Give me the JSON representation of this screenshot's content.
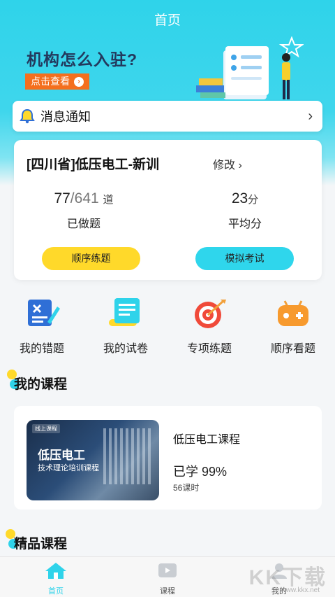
{
  "topbar": {
    "title": "首页"
  },
  "banner": {
    "title": "机构怎么入驻?",
    "button_label": "点击查看"
  },
  "notice": {
    "label": "消息通知"
  },
  "stats": {
    "course_name": "[四川省]低压电工-新训",
    "modify_label": "修改 ›",
    "done_count": "77",
    "total_count": "641",
    "count_unit": "道",
    "done_caption": "已做题",
    "avg_score": "23",
    "score_unit": "分",
    "avg_caption": "平均分",
    "btn_sequential": "顺序练题",
    "btn_mock": "模拟考试"
  },
  "quick_actions": [
    {
      "label": "我的错题",
      "icon": "wrong-questions-icon"
    },
    {
      "label": "我的试卷",
      "icon": "exam-paper-icon"
    },
    {
      "label": "专项练题",
      "icon": "target-icon"
    },
    {
      "label": "顺序看题",
      "icon": "gamepad-icon"
    }
  ],
  "my_courses": {
    "title": "我的课程",
    "course": {
      "thumb_tag": "线上课程",
      "thumb_title": "低压电工",
      "thumb_subtitle": "技术理论培训课程",
      "name": "低压电工课程",
      "progress_label": "已学",
      "progress_value": "99%",
      "progress": 0.99,
      "hours": "56课时"
    }
  },
  "featured": {
    "title": "精品课程"
  },
  "tabbar": {
    "home": "首页",
    "course": "课程",
    "mine": "我的"
  },
  "watermark": {
    "text": "KK下载",
    "url": "www.kkx.net"
  },
  "colors": {
    "accent": "#2fd3ea",
    "yellow": "#ffd92a",
    "orange": "#f46f1e"
  }
}
